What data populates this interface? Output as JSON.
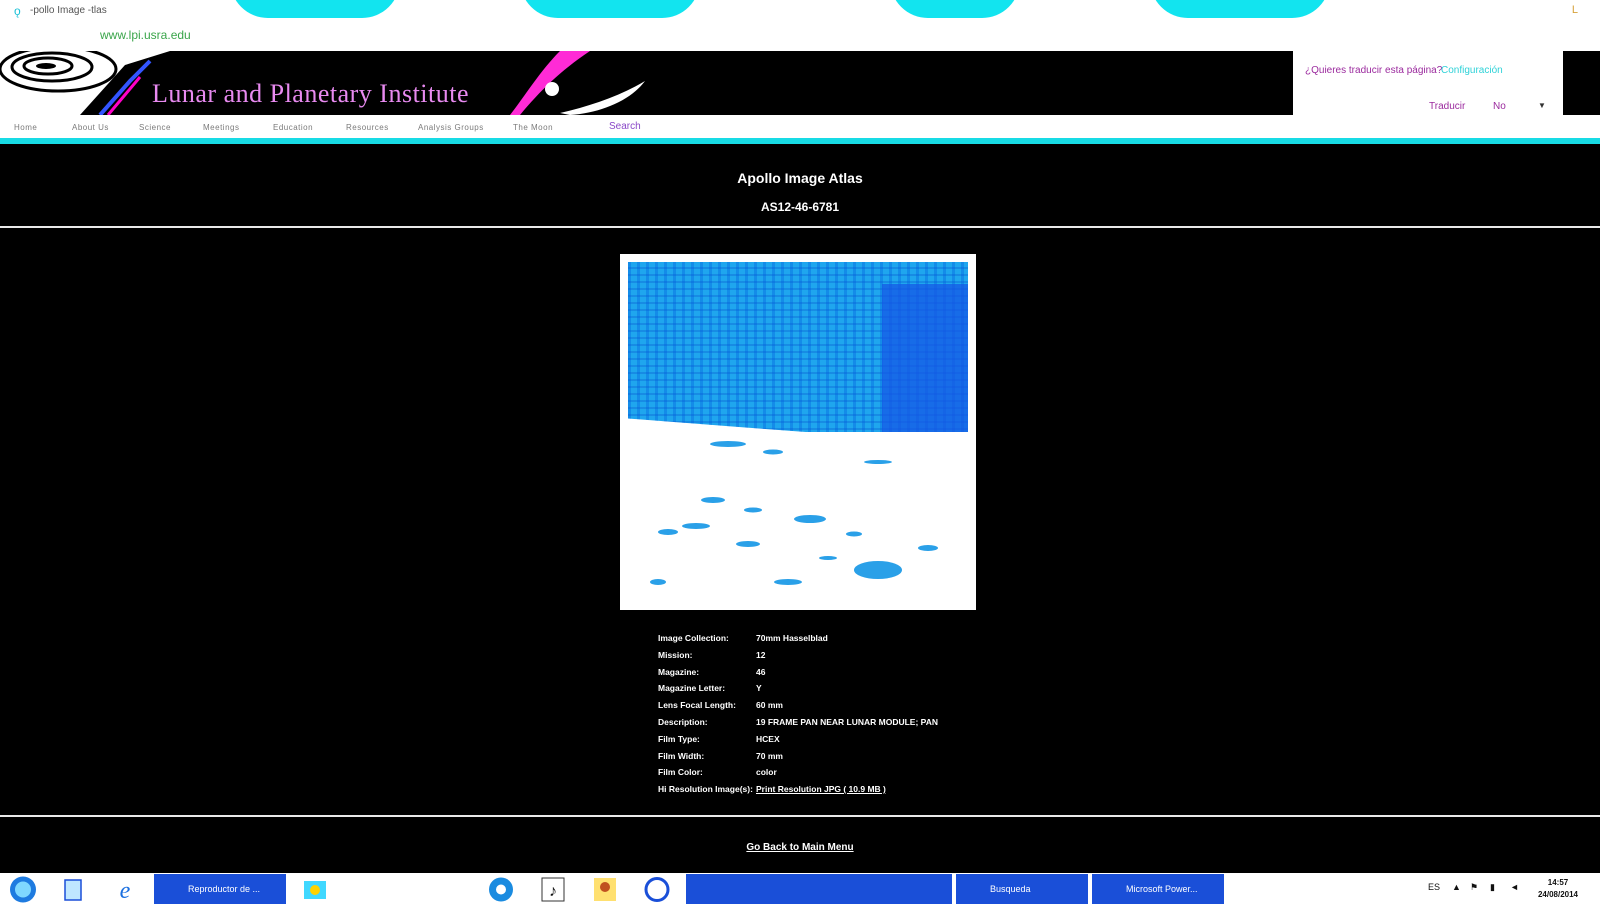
{
  "browser": {
    "tab_title": "-pollo Image -tlas",
    "url": "www.lpi.usra.edu"
  },
  "header": {
    "site_title": "Lunar and Planetary Institute",
    "translate": {
      "question": "¿Quieres traducir esta página?",
      "configure": "Configuración",
      "translate_button": "Traducir",
      "no_button": "No"
    }
  },
  "nav": {
    "items": [
      "Home",
      "About Us",
      "Science",
      "Meetings",
      "Education",
      "Resources",
      "Analysis Groups",
      "The Moon"
    ],
    "search_label": "Search"
  },
  "page": {
    "title": "Apollo Image Atlas",
    "image_id": "AS12-46-6781"
  },
  "metadata": [
    {
      "label": "Image Collection:",
      "value": "70mm Hasselblad"
    },
    {
      "label": "Mission:",
      "value": "12"
    },
    {
      "label": "Magazine:",
      "value": "46"
    },
    {
      "label": "Magazine Letter:",
      "value": "Y"
    },
    {
      "label": "Lens Focal Length:",
      "value": "60 mm"
    },
    {
      "label": "Description:",
      "value": "19 FRAME PAN NEAR LUNAR MODULE; PAN"
    },
    {
      "label": "Film Type:",
      "value": "HCEX"
    },
    {
      "label": "Film Width:",
      "value": "70 mm"
    },
    {
      "label": "Film Color:",
      "value": "color"
    },
    {
      "label": "Hi Resolution Image(s):",
      "value": "Print Resolution JPG ( 10.9 MB )"
    }
  ],
  "footer": {
    "back_link": "Go Back to Main Menu"
  },
  "taskbar": {
    "tasks": [
      "Reproductor de ...",
      "",
      "",
      "Busqueda",
      "Microsoft Power..."
    ],
    "language": "ES",
    "time": "14:57",
    "date": "24/08/2014"
  },
  "icons": [
    "start-orb-icon",
    "files-icon",
    "ie-icon",
    "media-player-icon",
    "paint-icon",
    "music-icon",
    "chrome-icon",
    "java-icon",
    "user-icon",
    "speaker-icon",
    "network-icon",
    "flag-icon"
  ]
}
